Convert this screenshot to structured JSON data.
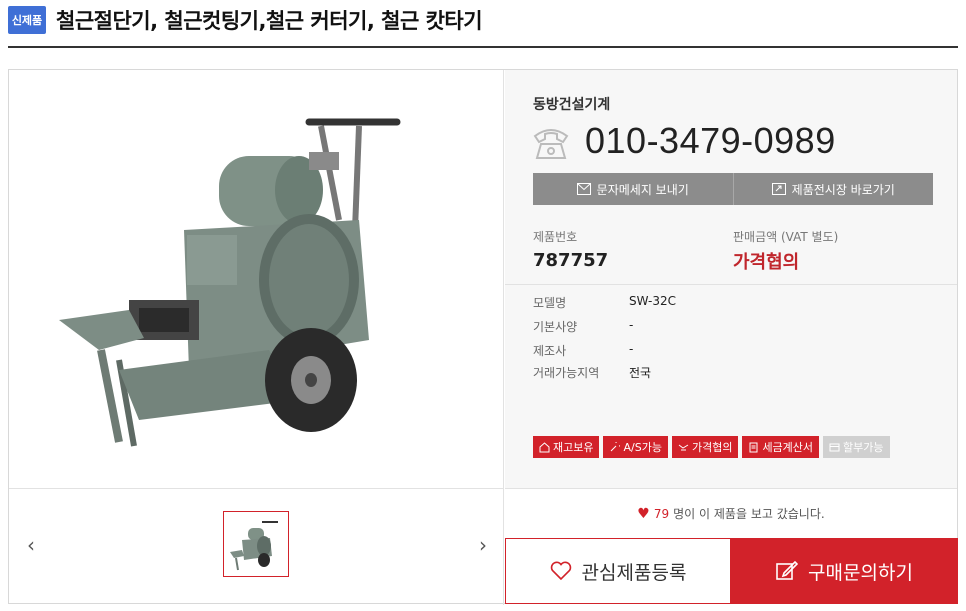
{
  "header": {
    "badge": "신제품",
    "title": "철근절단기, 철근컷팅기,철근 커터기, 철근 캇타기"
  },
  "seller": {
    "company": "동방건설기계",
    "phone": "010-3479-0989"
  },
  "buttons": {
    "message": "문자메세지 보내기",
    "showroom": "제품전시장 바로가기"
  },
  "product": {
    "number_label": "제품번호",
    "number": "787757",
    "price_label": "판매금액 (VAT 별도)",
    "price": "가격협의"
  },
  "specs": [
    {
      "key": "모델명",
      "value": "SW-32C"
    },
    {
      "key": "기본사양",
      "value": "-"
    },
    {
      "key": "제조사",
      "value": "-"
    },
    {
      "key": "거래가능지역",
      "value": "전국"
    }
  ],
  "tags": [
    {
      "label": "재고보유",
      "icon": "warehouse-icon",
      "active": true
    },
    {
      "label": "A/S가능",
      "icon": "wrench-icon",
      "active": true
    },
    {
      "label": "가격협의",
      "icon": "handshake-icon",
      "active": true
    },
    {
      "label": "세금계산서",
      "icon": "receipt-icon",
      "active": true
    },
    {
      "label": "할부가능",
      "icon": "card-icon",
      "active": false
    }
  ],
  "views": {
    "count": "79",
    "text": "명이 이 제품을 보고 갔습니다."
  },
  "actions": {
    "like": "관심제품등록",
    "buy": "구매문의하기"
  },
  "colors": {
    "accent": "#d2222a",
    "badge": "#3f6fd6",
    "gray_button": "#8c8c8c"
  }
}
